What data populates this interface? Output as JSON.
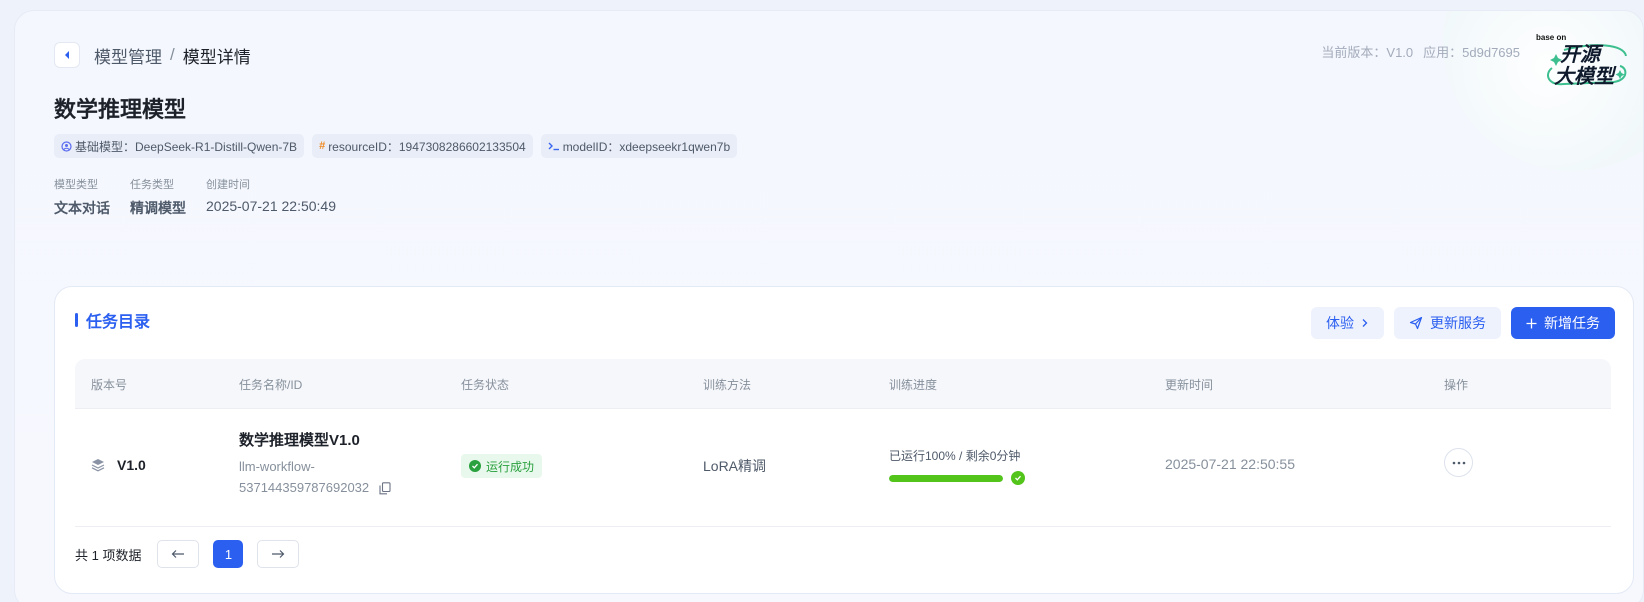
{
  "breadcrumb": {
    "parent": "模型管理",
    "separator": "/",
    "current": "模型详情"
  },
  "header_info": {
    "version": "当前版本：V1.0",
    "app": "应用：5d9d7695"
  },
  "logo": {
    "based_on": "base on",
    "line1": "开源",
    "line2": "大模型"
  },
  "model": {
    "title": "数学推理模型",
    "tags": [
      {
        "icon": "model-icon",
        "text": "基础模型：DeepSeek-R1-Distill-Qwen-7B"
      },
      {
        "icon": "hash-icon",
        "text": "resourceID：1947308286602133504"
      },
      {
        "icon": "terminal-icon",
        "text": "modelID：xdeepseekr1qwen7b"
      }
    ],
    "meta": [
      {
        "label": "模型类型",
        "value": "文本对话"
      },
      {
        "label": "任务类型",
        "value": "精调模型"
      },
      {
        "label": "创建时间",
        "value": "2025-07-21 22:50:49"
      }
    ]
  },
  "tasks": {
    "title": "任务目录",
    "buttons": {
      "try": "体验",
      "update_service": "更新服务",
      "new_task": "新增任务"
    },
    "columns": [
      "版本号",
      "任务名称/ID",
      "任务状态",
      "训练方法",
      "训练进度",
      "更新时间",
      "操作"
    ],
    "rows": [
      {
        "version": "V1.0",
        "name": "数学推理模型V1.0",
        "id_line1": "llm-workflow-",
        "id_line2": "537144359787692032",
        "status": "运行成功",
        "method": "LoRA精调",
        "progress_text": "已运行100% / 剩余0分钟",
        "progress_fraction": 1.0,
        "updated": "2025-07-21 22:50:55"
      }
    ],
    "pagination": {
      "total_text": "共 1 项数据",
      "current_page": "1"
    }
  },
  "colors": {
    "primary": "#2b5ff0",
    "success": "#52c41a",
    "status_green": "#2aa13f"
  }
}
